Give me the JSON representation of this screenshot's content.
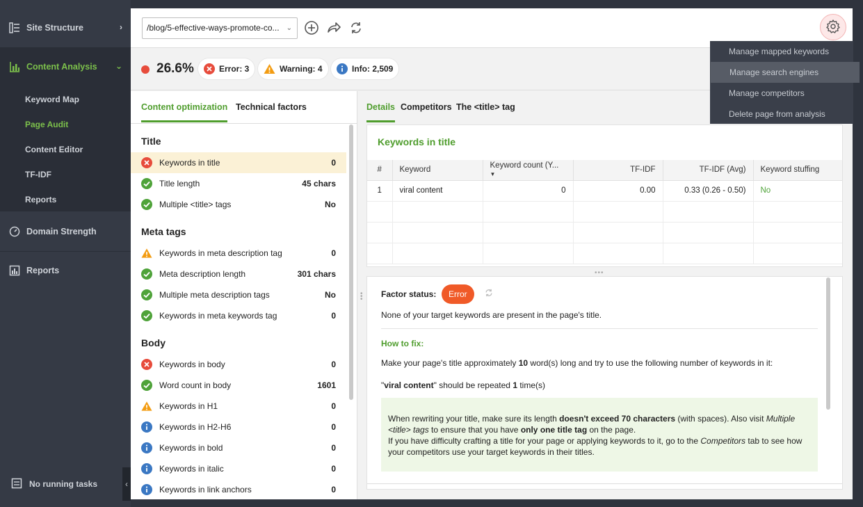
{
  "sidebar": {
    "items": [
      {
        "label": "Site Structure"
      },
      {
        "label": "Content Analysis"
      },
      {
        "label": "Domain Strength"
      },
      {
        "label": "Reports"
      }
    ],
    "sub_items": [
      {
        "label": "Keyword Map"
      },
      {
        "label": "Page Audit"
      },
      {
        "label": "Content Editor"
      },
      {
        "label": "TF-IDF"
      },
      {
        "label": "Reports"
      }
    ],
    "tasks_label": "No running tasks",
    "accent": "#7cc04b"
  },
  "toolbar": {
    "url_value": "/blog/5-effective-ways-promote-co..."
  },
  "status": {
    "score": "26.6%",
    "error": "Error: 3",
    "warning": "Warning: 4",
    "info": "Info: 2,509"
  },
  "left_tabs": [
    "Content optimization",
    "Technical factors"
  ],
  "sections": {
    "title": {
      "heading": "Title",
      "rows": [
        {
          "label": "Keywords in title",
          "value": "0",
          "status": "error"
        },
        {
          "label": "Title length",
          "value": "45 chars",
          "status": "ok"
        },
        {
          "label": "Multiple <title> tags",
          "value": "No",
          "status": "ok"
        }
      ]
    },
    "meta": {
      "heading": "Meta tags",
      "rows": [
        {
          "label": "Keywords in meta description tag",
          "value": "0",
          "status": "warning"
        },
        {
          "label": "Meta description length",
          "value": "301 chars",
          "status": "ok"
        },
        {
          "label": "Multiple meta description tags",
          "value": "No",
          "status": "ok"
        },
        {
          "label": "Keywords in meta keywords tag",
          "value": "0",
          "status": "ok"
        }
      ]
    },
    "body": {
      "heading": "Body",
      "rows": [
        {
          "label": "Keywords in body",
          "value": "0",
          "status": "error"
        },
        {
          "label": "Word count in body",
          "value": "1601",
          "status": "ok"
        },
        {
          "label": "Keywords in H1",
          "value": "0",
          "status": "warning"
        },
        {
          "label": "Keywords in H2-H6",
          "value": "0",
          "status": "info"
        },
        {
          "label": "Keywords in bold",
          "value": "0",
          "status": "info"
        },
        {
          "label": "Keywords in italic",
          "value": "0",
          "status": "info"
        },
        {
          "label": "Keywords in link anchors",
          "value": "0",
          "status": "info"
        }
      ]
    }
  },
  "right_tabs": [
    "Details",
    "Competitors",
    "The <title> tag"
  ],
  "card": {
    "title": "Keywords in title",
    "columns": [
      "#",
      "Keyword",
      "Keyword count (Y...",
      "TF-IDF",
      "TF-IDF (Avg)",
      "Keyword stuffing"
    ],
    "rows": [
      {
        "num": "1",
        "keyword": "viral content",
        "count": "0",
        "tfidf": "0.00",
        "avg": "0.33 (0.26 - 0.50)",
        "stuffing": "No"
      }
    ]
  },
  "factor": {
    "label": "Factor status:",
    "status": "Error",
    "message": "None of your target keywords are present in the page's title.",
    "how_to_fix": "How to fix:",
    "p1_a": "Make your page's title approximately ",
    "p1_b": "10",
    "p1_c": " word(s) long and try to use the following number of keywords in it:",
    "p2_a": "\"",
    "p2_b": "viral content",
    "p2_c": "\" should be repeated ",
    "p2_d": "1",
    "p2_e": " time(s)",
    "tip_1a": "When rewriting your title, make sure its length ",
    "tip_1b": "doesn't exceed 70 characters",
    "tip_1c": " (with spaces). Also visit ",
    "tip_1d": "Multiple <title> tags",
    "tip_1e": " to ensure that you have ",
    "tip_1f": "only one title tag",
    "tip_1g": " on the page.",
    "tip_2a": "If you have difficulty crafting a title for your page or applying keywords to it, go to the ",
    "tip_2b": "Competitors",
    "tip_2c": " tab to see how your competitors use your target keywords in their titles."
  },
  "menu": {
    "items": [
      {
        "label": "Manage mapped keywords"
      },
      {
        "label": "Manage search engines"
      },
      {
        "label": "Manage competitors"
      },
      {
        "label": "Delete page from analysis"
      }
    ]
  },
  "colors": {
    "error": "#e74c3c",
    "warning": "#f39c12",
    "ok": "#4fa33a",
    "info": "#3b78c3"
  }
}
